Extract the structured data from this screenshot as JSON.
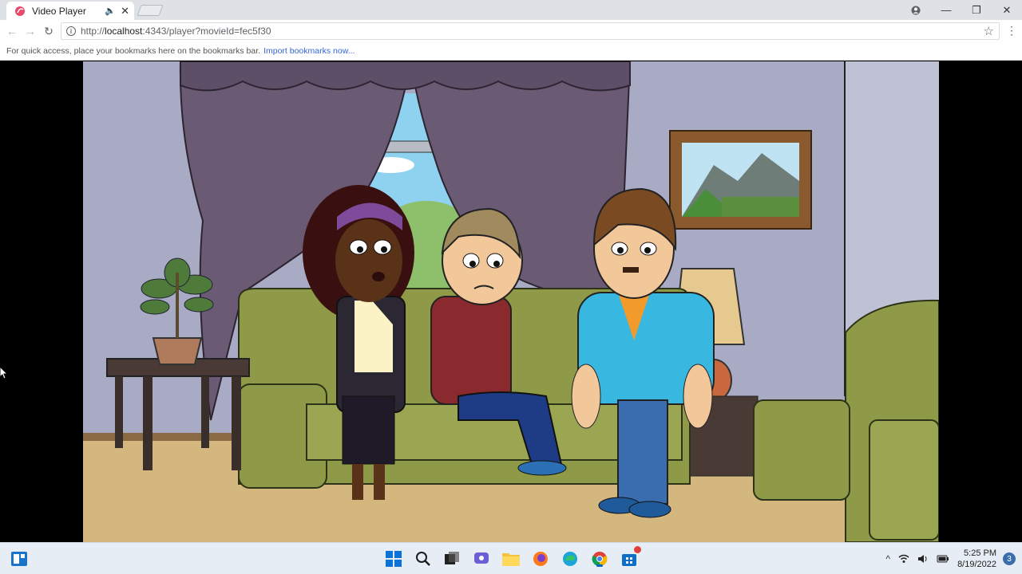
{
  "browser": {
    "tab": {
      "title": "Video Player",
      "favicon": "goanimate-icon",
      "speaker_icon": "speaker-icon",
      "close_glyph": "✕"
    },
    "window_controls": {
      "minimize": "—",
      "restore": "❐",
      "close": "✕"
    },
    "nav": {
      "back_glyph": "←",
      "forward_glyph": "→",
      "reload_glyph": "↻"
    },
    "address": {
      "prefix": "http://",
      "host": "localhost",
      "rest": ":4343/player?movieId=fec5f30"
    },
    "bookmarks_bar": {
      "hint": "For quick access, place your bookmarks here on the bookmarks bar.",
      "link": "Import bookmarks now..."
    }
  },
  "video": {
    "scene": "cartoon-living-room",
    "colors": {
      "wall": "#a9abc4",
      "floor": "#d3b77f",
      "curtain": "#6a5a73",
      "sofa": "#8e9a48"
    }
  },
  "taskbar": {
    "apps": [
      "start-icon",
      "search-icon",
      "task-view-icon",
      "chat-icon",
      "file-explorer-icon",
      "firefox-icon",
      "edge-icon",
      "chrome-icon",
      "store-icon"
    ],
    "clock": {
      "time": "5:25 PM",
      "date": "8/19/2022"
    },
    "notification_count": "3",
    "tray_chevron": "^"
  }
}
